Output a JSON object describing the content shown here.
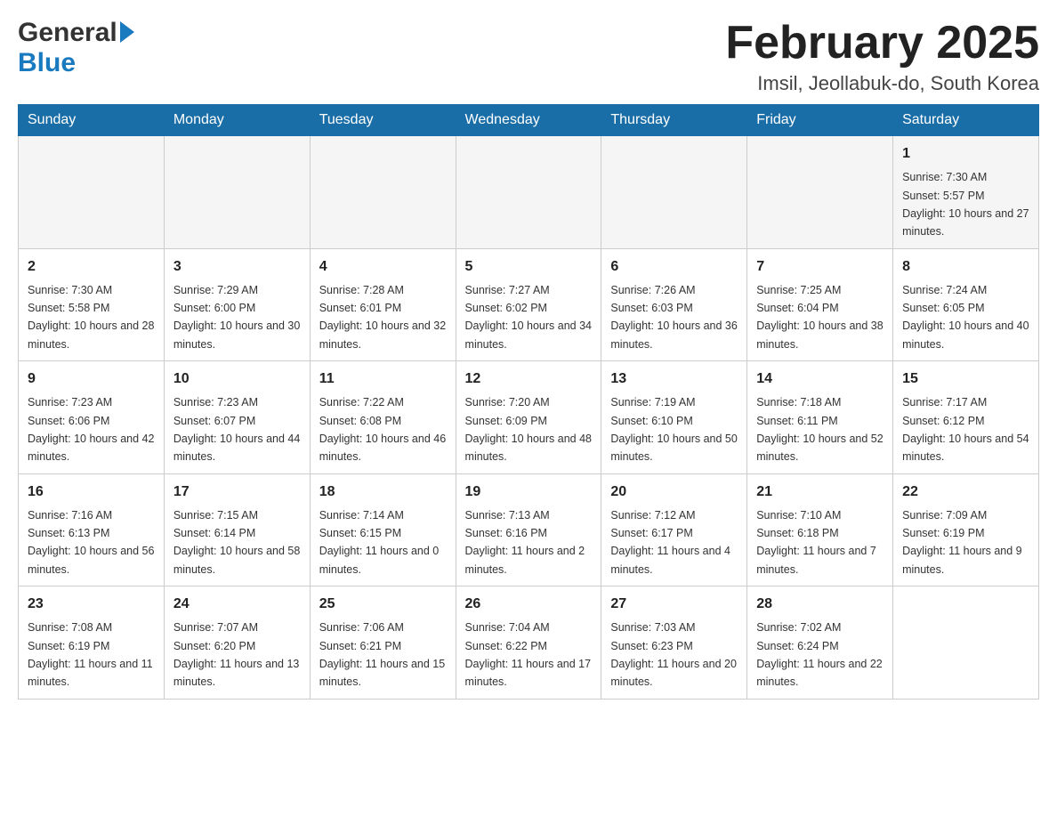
{
  "header": {
    "logo_general": "General",
    "logo_blue": "Blue",
    "month_title": "February 2025",
    "location": "Imsil, Jeollabuk-do, South Korea"
  },
  "days_of_week": [
    "Sunday",
    "Monday",
    "Tuesday",
    "Wednesday",
    "Thursday",
    "Friday",
    "Saturday"
  ],
  "weeks": [
    [
      {
        "day": "",
        "sunrise": "",
        "sunset": "",
        "daylight": ""
      },
      {
        "day": "",
        "sunrise": "",
        "sunset": "",
        "daylight": ""
      },
      {
        "day": "",
        "sunrise": "",
        "sunset": "",
        "daylight": ""
      },
      {
        "day": "",
        "sunrise": "",
        "sunset": "",
        "daylight": ""
      },
      {
        "day": "",
        "sunrise": "",
        "sunset": "",
        "daylight": ""
      },
      {
        "day": "",
        "sunrise": "",
        "sunset": "",
        "daylight": ""
      },
      {
        "day": "1",
        "sunrise": "Sunrise: 7:30 AM",
        "sunset": "Sunset: 5:57 PM",
        "daylight": "Daylight: 10 hours and 27 minutes."
      }
    ],
    [
      {
        "day": "2",
        "sunrise": "Sunrise: 7:30 AM",
        "sunset": "Sunset: 5:58 PM",
        "daylight": "Daylight: 10 hours and 28 minutes."
      },
      {
        "day": "3",
        "sunrise": "Sunrise: 7:29 AM",
        "sunset": "Sunset: 6:00 PM",
        "daylight": "Daylight: 10 hours and 30 minutes."
      },
      {
        "day": "4",
        "sunrise": "Sunrise: 7:28 AM",
        "sunset": "Sunset: 6:01 PM",
        "daylight": "Daylight: 10 hours and 32 minutes."
      },
      {
        "day": "5",
        "sunrise": "Sunrise: 7:27 AM",
        "sunset": "Sunset: 6:02 PM",
        "daylight": "Daylight: 10 hours and 34 minutes."
      },
      {
        "day": "6",
        "sunrise": "Sunrise: 7:26 AM",
        "sunset": "Sunset: 6:03 PM",
        "daylight": "Daylight: 10 hours and 36 minutes."
      },
      {
        "day": "7",
        "sunrise": "Sunrise: 7:25 AM",
        "sunset": "Sunset: 6:04 PM",
        "daylight": "Daylight: 10 hours and 38 minutes."
      },
      {
        "day": "8",
        "sunrise": "Sunrise: 7:24 AM",
        "sunset": "Sunset: 6:05 PM",
        "daylight": "Daylight: 10 hours and 40 minutes."
      }
    ],
    [
      {
        "day": "9",
        "sunrise": "Sunrise: 7:23 AM",
        "sunset": "Sunset: 6:06 PM",
        "daylight": "Daylight: 10 hours and 42 minutes."
      },
      {
        "day": "10",
        "sunrise": "Sunrise: 7:23 AM",
        "sunset": "Sunset: 6:07 PM",
        "daylight": "Daylight: 10 hours and 44 minutes."
      },
      {
        "day": "11",
        "sunrise": "Sunrise: 7:22 AM",
        "sunset": "Sunset: 6:08 PM",
        "daylight": "Daylight: 10 hours and 46 minutes."
      },
      {
        "day": "12",
        "sunrise": "Sunrise: 7:20 AM",
        "sunset": "Sunset: 6:09 PM",
        "daylight": "Daylight: 10 hours and 48 minutes."
      },
      {
        "day": "13",
        "sunrise": "Sunrise: 7:19 AM",
        "sunset": "Sunset: 6:10 PM",
        "daylight": "Daylight: 10 hours and 50 minutes."
      },
      {
        "day": "14",
        "sunrise": "Sunrise: 7:18 AM",
        "sunset": "Sunset: 6:11 PM",
        "daylight": "Daylight: 10 hours and 52 minutes."
      },
      {
        "day": "15",
        "sunrise": "Sunrise: 7:17 AM",
        "sunset": "Sunset: 6:12 PM",
        "daylight": "Daylight: 10 hours and 54 minutes."
      }
    ],
    [
      {
        "day": "16",
        "sunrise": "Sunrise: 7:16 AM",
        "sunset": "Sunset: 6:13 PM",
        "daylight": "Daylight: 10 hours and 56 minutes."
      },
      {
        "day": "17",
        "sunrise": "Sunrise: 7:15 AM",
        "sunset": "Sunset: 6:14 PM",
        "daylight": "Daylight: 10 hours and 58 minutes."
      },
      {
        "day": "18",
        "sunrise": "Sunrise: 7:14 AM",
        "sunset": "Sunset: 6:15 PM",
        "daylight": "Daylight: 11 hours and 0 minutes."
      },
      {
        "day": "19",
        "sunrise": "Sunrise: 7:13 AM",
        "sunset": "Sunset: 6:16 PM",
        "daylight": "Daylight: 11 hours and 2 minutes."
      },
      {
        "day": "20",
        "sunrise": "Sunrise: 7:12 AM",
        "sunset": "Sunset: 6:17 PM",
        "daylight": "Daylight: 11 hours and 4 minutes."
      },
      {
        "day": "21",
        "sunrise": "Sunrise: 7:10 AM",
        "sunset": "Sunset: 6:18 PM",
        "daylight": "Daylight: 11 hours and 7 minutes."
      },
      {
        "day": "22",
        "sunrise": "Sunrise: 7:09 AM",
        "sunset": "Sunset: 6:19 PM",
        "daylight": "Daylight: 11 hours and 9 minutes."
      }
    ],
    [
      {
        "day": "23",
        "sunrise": "Sunrise: 7:08 AM",
        "sunset": "Sunset: 6:19 PM",
        "daylight": "Daylight: 11 hours and 11 minutes."
      },
      {
        "day": "24",
        "sunrise": "Sunrise: 7:07 AM",
        "sunset": "Sunset: 6:20 PM",
        "daylight": "Daylight: 11 hours and 13 minutes."
      },
      {
        "day": "25",
        "sunrise": "Sunrise: 7:06 AM",
        "sunset": "Sunset: 6:21 PM",
        "daylight": "Daylight: 11 hours and 15 minutes."
      },
      {
        "day": "26",
        "sunrise": "Sunrise: 7:04 AM",
        "sunset": "Sunset: 6:22 PM",
        "daylight": "Daylight: 11 hours and 17 minutes."
      },
      {
        "day": "27",
        "sunrise": "Sunrise: 7:03 AM",
        "sunset": "Sunset: 6:23 PM",
        "daylight": "Daylight: 11 hours and 20 minutes."
      },
      {
        "day": "28",
        "sunrise": "Sunrise: 7:02 AM",
        "sunset": "Sunset: 6:24 PM",
        "daylight": "Daylight: 11 hours and 22 minutes."
      },
      {
        "day": "",
        "sunrise": "",
        "sunset": "",
        "daylight": ""
      }
    ]
  ]
}
